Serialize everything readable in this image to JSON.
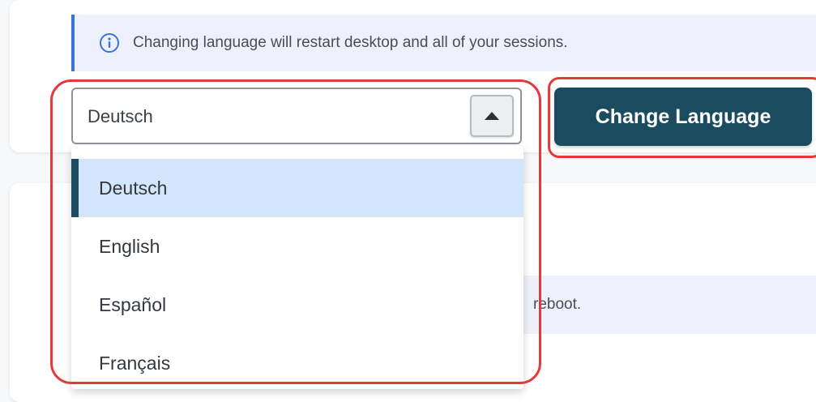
{
  "info_banner": {
    "icon": "info-icon",
    "text": "Changing language will restart desktop and all of your sessions."
  },
  "language_select": {
    "selected_value": "Deutsch",
    "toggle_icon": "caret-up-icon",
    "options": [
      "Deutsch",
      "English",
      "Español",
      "Français"
    ]
  },
  "change_button": {
    "label": "Change Language"
  },
  "lower_card": {
    "partial_text": "reboot."
  },
  "colors": {
    "accent": "#1b4b5f",
    "info_border": "#3b74d6",
    "selected_option_bg": "#d3e6fb",
    "highlight": "#e5383b"
  }
}
